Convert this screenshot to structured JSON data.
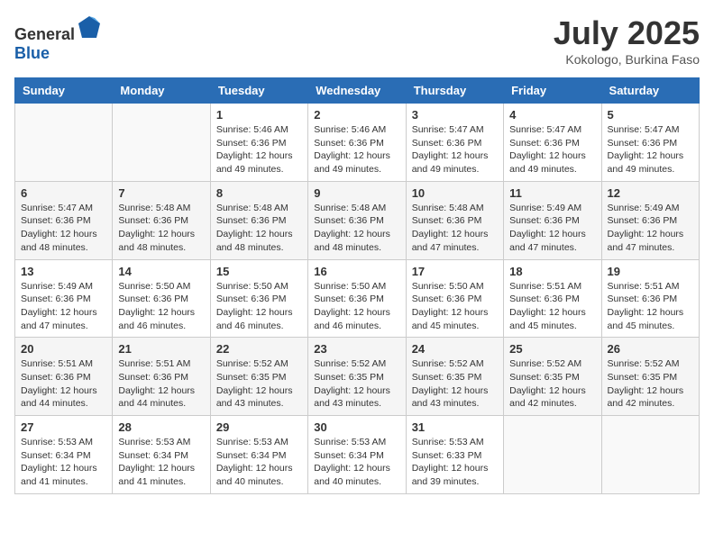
{
  "header": {
    "logo_general": "General",
    "logo_blue": "Blue",
    "month_year": "July 2025",
    "location": "Kokologo, Burkina Faso"
  },
  "weekdays": [
    "Sunday",
    "Monday",
    "Tuesday",
    "Wednesday",
    "Thursday",
    "Friday",
    "Saturday"
  ],
  "weeks": [
    [
      {
        "day": "",
        "sunrise": "",
        "sunset": "",
        "daylight": ""
      },
      {
        "day": "",
        "sunrise": "",
        "sunset": "",
        "daylight": ""
      },
      {
        "day": "1",
        "sunrise": "Sunrise: 5:46 AM",
        "sunset": "Sunset: 6:36 PM",
        "daylight": "Daylight: 12 hours and 49 minutes."
      },
      {
        "day": "2",
        "sunrise": "Sunrise: 5:46 AM",
        "sunset": "Sunset: 6:36 PM",
        "daylight": "Daylight: 12 hours and 49 minutes."
      },
      {
        "day": "3",
        "sunrise": "Sunrise: 5:47 AM",
        "sunset": "Sunset: 6:36 PM",
        "daylight": "Daylight: 12 hours and 49 minutes."
      },
      {
        "day": "4",
        "sunrise": "Sunrise: 5:47 AM",
        "sunset": "Sunset: 6:36 PM",
        "daylight": "Daylight: 12 hours and 49 minutes."
      },
      {
        "day": "5",
        "sunrise": "Sunrise: 5:47 AM",
        "sunset": "Sunset: 6:36 PM",
        "daylight": "Daylight: 12 hours and 49 minutes."
      }
    ],
    [
      {
        "day": "6",
        "sunrise": "Sunrise: 5:47 AM",
        "sunset": "Sunset: 6:36 PM",
        "daylight": "Daylight: 12 hours and 48 minutes."
      },
      {
        "day": "7",
        "sunrise": "Sunrise: 5:48 AM",
        "sunset": "Sunset: 6:36 PM",
        "daylight": "Daylight: 12 hours and 48 minutes."
      },
      {
        "day": "8",
        "sunrise": "Sunrise: 5:48 AM",
        "sunset": "Sunset: 6:36 PM",
        "daylight": "Daylight: 12 hours and 48 minutes."
      },
      {
        "day": "9",
        "sunrise": "Sunrise: 5:48 AM",
        "sunset": "Sunset: 6:36 PM",
        "daylight": "Daylight: 12 hours and 48 minutes."
      },
      {
        "day": "10",
        "sunrise": "Sunrise: 5:48 AM",
        "sunset": "Sunset: 6:36 PM",
        "daylight": "Daylight: 12 hours and 47 minutes."
      },
      {
        "day": "11",
        "sunrise": "Sunrise: 5:49 AM",
        "sunset": "Sunset: 6:36 PM",
        "daylight": "Daylight: 12 hours and 47 minutes."
      },
      {
        "day": "12",
        "sunrise": "Sunrise: 5:49 AM",
        "sunset": "Sunset: 6:36 PM",
        "daylight": "Daylight: 12 hours and 47 minutes."
      }
    ],
    [
      {
        "day": "13",
        "sunrise": "Sunrise: 5:49 AM",
        "sunset": "Sunset: 6:36 PM",
        "daylight": "Daylight: 12 hours and 47 minutes."
      },
      {
        "day": "14",
        "sunrise": "Sunrise: 5:50 AM",
        "sunset": "Sunset: 6:36 PM",
        "daylight": "Daylight: 12 hours and 46 minutes."
      },
      {
        "day": "15",
        "sunrise": "Sunrise: 5:50 AM",
        "sunset": "Sunset: 6:36 PM",
        "daylight": "Daylight: 12 hours and 46 minutes."
      },
      {
        "day": "16",
        "sunrise": "Sunrise: 5:50 AM",
        "sunset": "Sunset: 6:36 PM",
        "daylight": "Daylight: 12 hours and 46 minutes."
      },
      {
        "day": "17",
        "sunrise": "Sunrise: 5:50 AM",
        "sunset": "Sunset: 6:36 PM",
        "daylight": "Daylight: 12 hours and 45 minutes."
      },
      {
        "day": "18",
        "sunrise": "Sunrise: 5:51 AM",
        "sunset": "Sunset: 6:36 PM",
        "daylight": "Daylight: 12 hours and 45 minutes."
      },
      {
        "day": "19",
        "sunrise": "Sunrise: 5:51 AM",
        "sunset": "Sunset: 6:36 PM",
        "daylight": "Daylight: 12 hours and 45 minutes."
      }
    ],
    [
      {
        "day": "20",
        "sunrise": "Sunrise: 5:51 AM",
        "sunset": "Sunset: 6:36 PM",
        "daylight": "Daylight: 12 hours and 44 minutes."
      },
      {
        "day": "21",
        "sunrise": "Sunrise: 5:51 AM",
        "sunset": "Sunset: 6:36 PM",
        "daylight": "Daylight: 12 hours and 44 minutes."
      },
      {
        "day": "22",
        "sunrise": "Sunrise: 5:52 AM",
        "sunset": "Sunset: 6:35 PM",
        "daylight": "Daylight: 12 hours and 43 minutes."
      },
      {
        "day": "23",
        "sunrise": "Sunrise: 5:52 AM",
        "sunset": "Sunset: 6:35 PM",
        "daylight": "Daylight: 12 hours and 43 minutes."
      },
      {
        "day": "24",
        "sunrise": "Sunrise: 5:52 AM",
        "sunset": "Sunset: 6:35 PM",
        "daylight": "Daylight: 12 hours and 43 minutes."
      },
      {
        "day": "25",
        "sunrise": "Sunrise: 5:52 AM",
        "sunset": "Sunset: 6:35 PM",
        "daylight": "Daylight: 12 hours and 42 minutes."
      },
      {
        "day": "26",
        "sunrise": "Sunrise: 5:52 AM",
        "sunset": "Sunset: 6:35 PM",
        "daylight": "Daylight: 12 hours and 42 minutes."
      }
    ],
    [
      {
        "day": "27",
        "sunrise": "Sunrise: 5:53 AM",
        "sunset": "Sunset: 6:34 PM",
        "daylight": "Daylight: 12 hours and 41 minutes."
      },
      {
        "day": "28",
        "sunrise": "Sunrise: 5:53 AM",
        "sunset": "Sunset: 6:34 PM",
        "daylight": "Daylight: 12 hours and 41 minutes."
      },
      {
        "day": "29",
        "sunrise": "Sunrise: 5:53 AM",
        "sunset": "Sunset: 6:34 PM",
        "daylight": "Daylight: 12 hours and 40 minutes."
      },
      {
        "day": "30",
        "sunrise": "Sunrise: 5:53 AM",
        "sunset": "Sunset: 6:34 PM",
        "daylight": "Daylight: 12 hours and 40 minutes."
      },
      {
        "day": "31",
        "sunrise": "Sunrise: 5:53 AM",
        "sunset": "Sunset: 6:33 PM",
        "daylight": "Daylight: 12 hours and 39 minutes."
      },
      {
        "day": "",
        "sunrise": "",
        "sunset": "",
        "daylight": ""
      },
      {
        "day": "",
        "sunrise": "",
        "sunset": "",
        "daylight": ""
      }
    ]
  ]
}
